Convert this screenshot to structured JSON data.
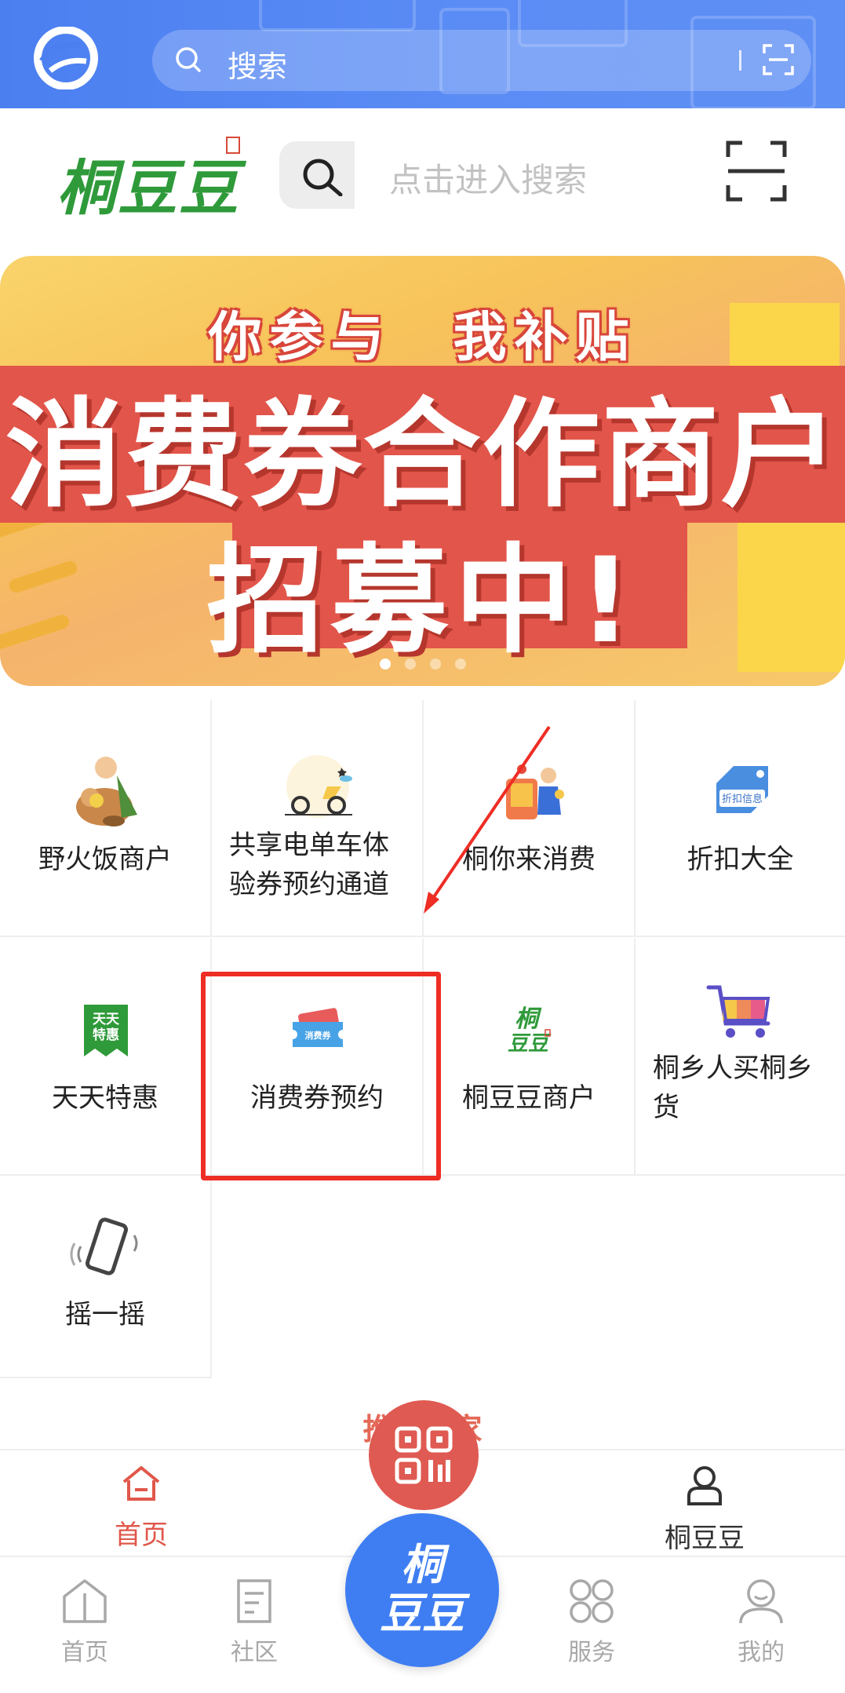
{
  "topbar": {
    "search_label": "搜索"
  },
  "brand": {
    "logo_text": "桐豆豆",
    "search_placeholder": "点击进入搜索"
  },
  "banner": {
    "subtitle": "你参与　我补贴",
    "line1": "消费券合作商户",
    "line2": "招募中!",
    "page_count": 4,
    "active_page": 1
  },
  "grid": [
    {
      "label": "野火饭商户",
      "icon": "farmer-basket-icon"
    },
    {
      "label": "共享电单车体验券预约通道",
      "icon": "scooter-icon"
    },
    {
      "label": "桐你来消费",
      "icon": "shopping-person-icon"
    },
    {
      "label": "折扣大全",
      "icon": "discount-tag-icon"
    },
    {
      "label": "天天特惠",
      "icon": "daily-deal-icon",
      "icon_text": "天天特惠"
    },
    {
      "label": "消费券预约",
      "icon": "coupon-icon",
      "icon_text": "消费券"
    },
    {
      "label": "桐豆豆商户",
      "icon": "tongdoudou-logo-icon",
      "icon_text": "桐豆豆"
    },
    {
      "label": "桐乡人买桐乡货",
      "icon": "shopping-cart-icon"
    },
    {
      "label": "摇一摇",
      "icon": "shake-phone-icon"
    }
  ],
  "discount_icon_text": "折扣信息",
  "hint_text": "推荐商家",
  "tabs_inner": [
    {
      "label": "首页",
      "active": true,
      "color": "#e0574a"
    },
    {
      "label": "桐豆豆",
      "active": false,
      "color": "#333333"
    }
  ],
  "tabs_outer": [
    {
      "label": "首页"
    },
    {
      "label": "社区"
    },
    {
      "label": "服务"
    },
    {
      "label": "我的"
    }
  ],
  "center_button": {
    "line1": "桐",
    "line2": "豆豆"
  },
  "colors": {
    "accent_blue": "#4b7ff0",
    "accent_red": "#e0574a",
    "brand_green": "#2f9a3a",
    "highlight_red": "#ee2d24"
  }
}
